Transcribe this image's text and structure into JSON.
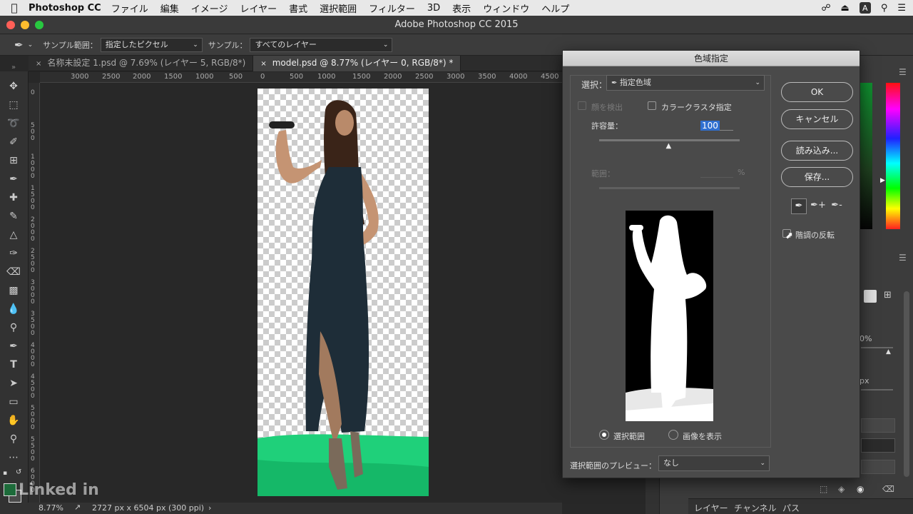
{
  "menubar": {
    "app_name": "Photoshop CC",
    "items": [
      "ファイル",
      "編集",
      "イメージ",
      "レイヤー",
      "書式",
      "選択範囲",
      "フィルター",
      "3D",
      "表示",
      "ウィンドウ",
      "ヘルプ"
    ],
    "right_badge": "A"
  },
  "window": {
    "title": "Adobe Photoshop CC 2015"
  },
  "options": {
    "sample_range_label": "サンプル範囲：",
    "sample_range_value": "指定したピクセル",
    "sample_label": "サンプル：",
    "sample_value": "すべてのレイヤー"
  },
  "tabs": [
    {
      "label": "名称未設定 1.psd @ 7.69% (レイヤー 5, RGB/8*)",
      "close": "×"
    },
    {
      "label": "model.psd @ 8.77% (レイヤー 0, RGB/8*) *",
      "close": "×"
    }
  ],
  "ruler": {
    "top": [
      "3000",
      "2500",
      "2000",
      "1500",
      "1000",
      "500",
      "0",
      "500",
      "1000",
      "1500",
      "2000",
      "2500",
      "3000",
      "3500",
      "4000",
      "4500"
    ],
    "left": [
      "0",
      "5\n0\n0",
      "1\n0\n0\n0",
      "1\n5\n0\n0",
      "2\n0\n0\n0",
      "2\n5\n0\n0",
      "3\n0\n0\n0",
      "3\n5\n0\n0",
      "4\n0\n0\n0",
      "4\n5\n0\n0",
      "5\n0\n0\n0",
      "5\n5\n0\n0",
      "6\n0\n0\n0"
    ]
  },
  "status": {
    "zoom": "8.77%",
    "doc_size": "2727 px x 6504 px (300 ppi)",
    "arrow": "›"
  },
  "dialog": {
    "title": "色域指定",
    "select_label": "選択：",
    "select_value": "指定色域",
    "detect_faces": "顔を検出",
    "localized_clusters": "カラークラスタ指定",
    "fuzziness_label": "許容量：",
    "fuzziness_value": "100",
    "fuzziness_level": 0.5,
    "range_label": "範囲：",
    "range_unit": "%",
    "ok": "OK",
    "cancel": "キャンセル",
    "load": "読み込み...",
    "save": "保存...",
    "invert": "階調の反転",
    "radio_selection": "選択範囲",
    "radio_image": "画像を表示",
    "preview_label": "選択範囲のプレビュー：",
    "preview_value": "なし"
  },
  "panels": {
    "bottom_tabs": [
      "レイヤー",
      "チャンネル",
      "パス"
    ],
    "opacity_fragment": "0%",
    "px_fragment": "px"
  },
  "watermark": "Linked in",
  "colors": {
    "accent_green": "#1fd07a",
    "dress": "#1e2d38"
  }
}
